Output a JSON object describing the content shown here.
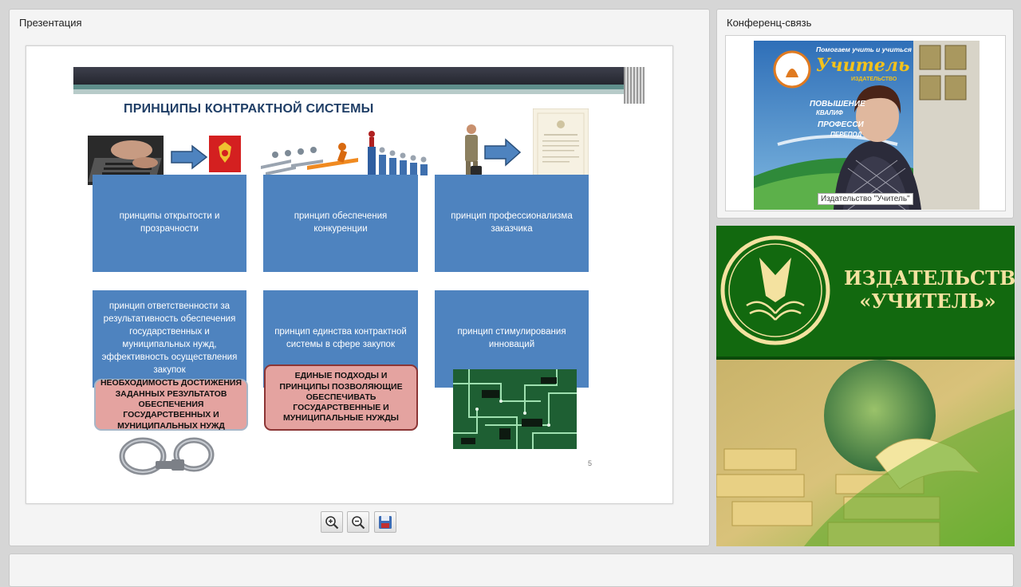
{
  "presentation": {
    "panel_title": "Презентация",
    "slide": {
      "title": "ПРИНЦИПЫ КОНТРАКТНОЙ СИСТЕМЫ",
      "page_number": "5",
      "boxes": [
        "принципы открытости и прозрачности",
        "принцип обеспечения конкуренции",
        "принцип профессионализма заказчика",
        "принцип ответственности за результативность обеспечения государственных и муниципальных нужд, эффективность осуществления закупок",
        "принцип единства контрактной системы в сфере закупок",
        "принцип стимулирования инноваций"
      ],
      "pink_boxes": [
        "НЕОБХОДИМОСТЬ ДОСТИЖЕНИЯ ЗАДАННЫХ РЕЗУЛЬТАТОВ  ОБЕСПЕЧЕНИЯ ГОСУДАРСТВЕННЫХ И МУНИЦИПАЛЬНЫХ НУЖД",
        "ЕДИНЫЕ ПОДХОДЫ И ПРИНЦИПЫ ПОЗВОЛЯЮЩИЕ ОБЕСПЕЧИВАТЬ ГОСУДАРСТВЕННЫЕ И МУНИЦИПАЛЬНЫЕ НУЖДЫ"
      ]
    },
    "toolbar": [
      "zoom-in-icon",
      "zoom-out-icon",
      "save-icon"
    ]
  },
  "conference": {
    "panel_title": "Конференц-связь",
    "participant_label": "Издательство \"Учитель\"",
    "backdrop_text": {
      "line1": "Помогаем учить и учиться",
      "brand": "Учитель",
      "line2": "ИЗДАТЕЛЬСТВО",
      "items": [
        "ПОВЫШЕНИЕ",
        "КВАЛИФ",
        "ПРОФЕССИ",
        "ПЕРЕПОД"
      ]
    }
  },
  "banner": {
    "line1": "ИЗДАТЕЛЬСТВО",
    "line2": "«УЧИТЕЛЬ»"
  },
  "colors": {
    "box_blue": "#4e83bf",
    "pink": "#e4a3a0",
    "pink_border": "#8b3535",
    "banner_green": "#12690f",
    "title_blue": "#1f3e66"
  }
}
